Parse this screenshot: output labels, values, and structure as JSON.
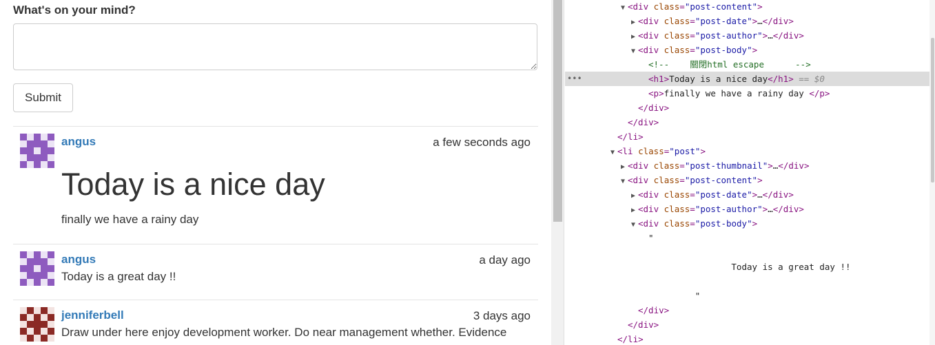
{
  "form": {
    "prompt": "What's on your mind?",
    "textarea_value": "",
    "submit_label": "Submit"
  },
  "posts": [
    {
      "author": "angus",
      "date": "a few seconds ago",
      "title": "Today is a nice day",
      "body": "finally we have a rainy day"
    },
    {
      "author": "angus",
      "date": "a day ago",
      "body": "Today is a great day !!"
    },
    {
      "author": "jenniferbell",
      "date": "3 days ago",
      "body": "Draw under here enjoy development worker. Do near management whether. Evidence"
    }
  ],
  "devtools": {
    "lines": [
      {
        "indent": 5,
        "tri": "open",
        "html": "<div class=\"post-content\">"
      },
      {
        "indent": 6,
        "tri": "closed",
        "html": "<div class=\"post-date\">…</div>"
      },
      {
        "indent": 6,
        "tri": "closed",
        "html": "<div class=\"post-author\">…</div>"
      },
      {
        "indent": 6,
        "tri": "open",
        "html": "<div class=\"post-body\">"
      },
      {
        "indent": 7,
        "tri": "",
        "comment": "<!--    關閉html escape      -->"
      },
      {
        "indent": 7,
        "tri": "",
        "html": "<h1>Today is a nice day</h1>",
        "suffix": " == $0",
        "selected": true
      },
      {
        "indent": 7,
        "tri": "",
        "html": "<p>finally we have a rainy day </p>"
      },
      {
        "indent": 6,
        "tri": "",
        "html": "</div>"
      },
      {
        "indent": 5,
        "tri": "",
        "html": "</div>"
      },
      {
        "indent": 4,
        "tri": "",
        "html": "</li>"
      },
      {
        "indent": 4,
        "tri": "open",
        "html": "<li class=\"post\">"
      },
      {
        "indent": 5,
        "tri": "closed",
        "html": "<div class=\"post-thumbnail\">…</div>"
      },
      {
        "indent": 5,
        "tri": "open",
        "html": "<div class=\"post-content\">"
      },
      {
        "indent": 6,
        "tri": "closed",
        "html": "<div class=\"post-date\">…</div>"
      },
      {
        "indent": 6,
        "tri": "closed",
        "html": "<div class=\"post-author\">…</div>"
      },
      {
        "indent": 6,
        "tri": "open",
        "html": "<div class=\"post-body\">"
      },
      {
        "indent": 7,
        "tri": "",
        "text": "\""
      },
      {
        "indent": 7,
        "tri": "",
        "text": ""
      },
      {
        "indent": 7,
        "tri": "",
        "text": "                Today is a great day !!"
      },
      {
        "indent": 7,
        "tri": "",
        "text": ""
      },
      {
        "indent": 7,
        "tri": "",
        "text": "         \""
      },
      {
        "indent": 6,
        "tri": "",
        "html": "</div>"
      },
      {
        "indent": 5,
        "tri": "",
        "html": "</div>"
      },
      {
        "indent": 4,
        "tri": "",
        "html": "</li>"
      }
    ],
    "selected_marker": "•••"
  },
  "colors": {
    "link": "#337ab7",
    "identicon_purple": "#8e5bbf",
    "identicon_red": "#8b2a25"
  }
}
